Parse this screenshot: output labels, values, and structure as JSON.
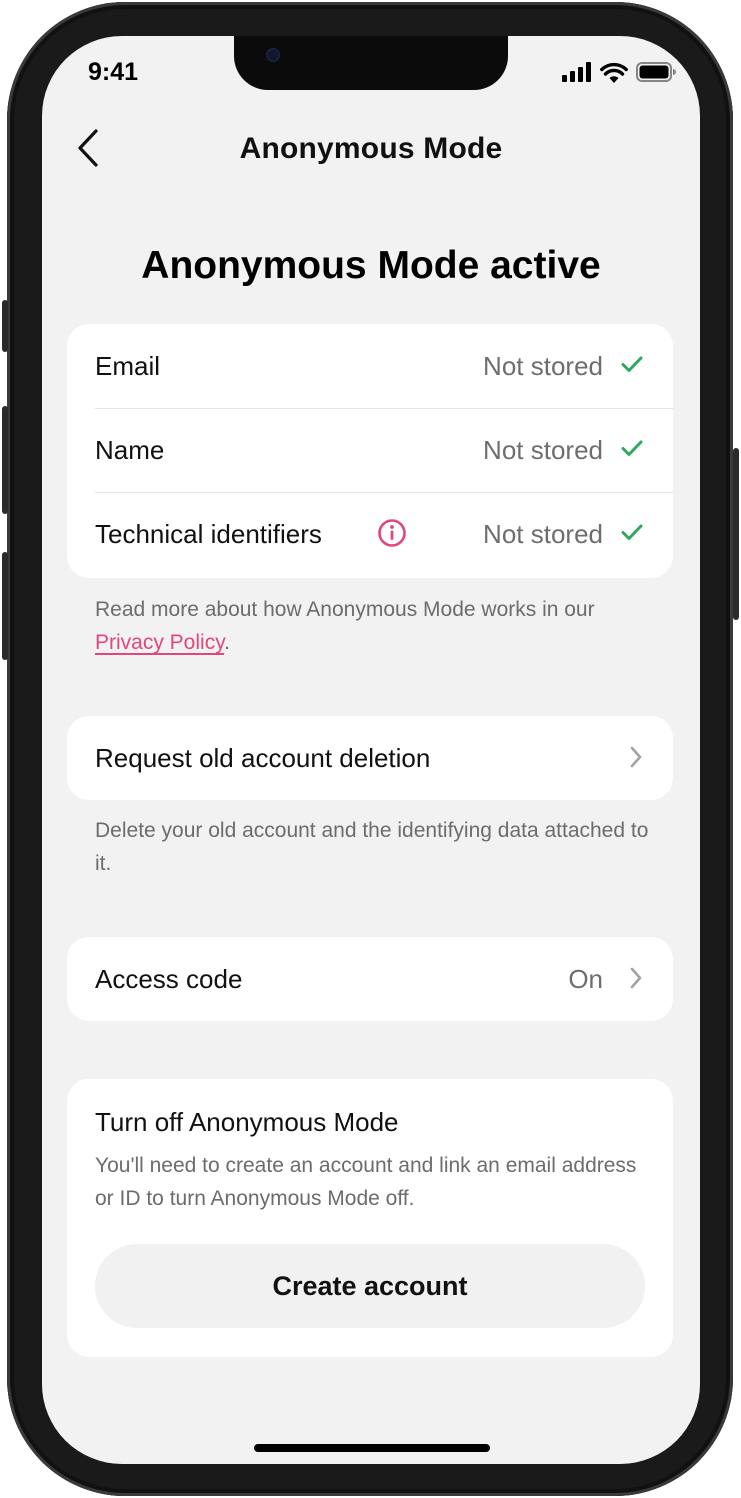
{
  "status_bar": {
    "time": "9:41"
  },
  "nav": {
    "title": "Anonymous Mode"
  },
  "header": {
    "title": "Anonymous Mode active"
  },
  "data_rows": [
    {
      "label": "Email",
      "value": "Not stored"
    },
    {
      "label": "Name",
      "value": "Not stored"
    },
    {
      "label": "Technical identifiers",
      "value": "Not stored"
    }
  ],
  "privacy_note": {
    "prefix": "Read more about how Anonymous Mode works in our ",
    "link": "Privacy Policy",
    "suffix": "."
  },
  "deletion": {
    "label": "Request old account deletion",
    "note": "Delete your old account and the identifying data attached to it."
  },
  "access_code": {
    "label": "Access code",
    "value": "On"
  },
  "turn_off": {
    "title": "Turn off Anonymous Mode",
    "description": "You'll need to create an account and link an email address or ID to turn Anonymous Mode off.",
    "button": "Create account"
  },
  "colors": {
    "accent": "#e0487a",
    "check": "#2eaa5c",
    "background": "#f2f2f2"
  },
  "icons": [
    "back-chevron-icon",
    "check-icon",
    "info-icon",
    "chevron-right-icon",
    "signal-icon",
    "wifi-icon",
    "battery-icon"
  ]
}
